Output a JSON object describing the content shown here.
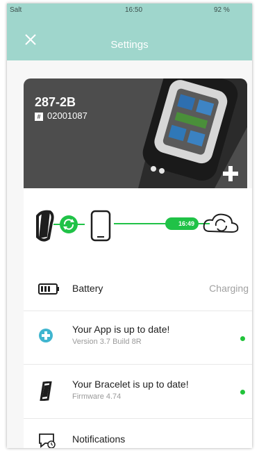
{
  "statusbar": {
    "carrier": "Salt",
    "time": "16:50",
    "battery": "92 %"
  },
  "header": {
    "title": "Settings"
  },
  "device": {
    "id": "287-2B",
    "serial_icon": "#",
    "serial": "02001087",
    "sync_time": "16:49"
  },
  "rows": {
    "battery": {
      "label": "Battery",
      "value": "Charging"
    },
    "app": {
      "title": "Your App is up to date!",
      "subtitle": "Version 3.7 Build 8R"
    },
    "bracelet": {
      "title": "Your Bracelet is up to date!",
      "subtitle": "Firmware 4.74"
    },
    "notifications": {
      "label": "Notifications"
    }
  },
  "icons": {
    "close": "close-icon",
    "add": "plus-icon",
    "bracelet": "bracelet-icon",
    "sync": "sync-icon",
    "phone": "phone-icon",
    "cloud": "cloud-sync-icon",
    "battery": "battery-icon",
    "app": "app-update-icon",
    "notifications": "notifications-icon"
  },
  "colors": {
    "header": "#9fd6cc",
    "accent_green": "#20c247",
    "status_dot": "#21c33a",
    "hero_bg": "#4d4d4d",
    "app_icon": "#3fb5cf"
  }
}
